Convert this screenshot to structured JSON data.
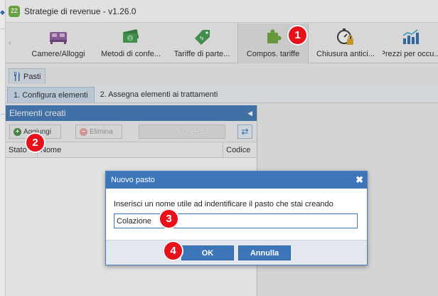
{
  "window": {
    "title": "Strategie di revenue - v1.26.0",
    "app_icon_text": "ZZ",
    "app_icon_color": "#6cb33e"
  },
  "ribbon": {
    "tabs": [
      {
        "label": "Camere/Alloggi",
        "icon": "bed-icon"
      },
      {
        "label": "Metodi di confe...",
        "icon": "money-icon"
      },
      {
        "label": "Tariffe di parte...",
        "icon": "price-tag-icon"
      },
      {
        "label": "Compos. tariffe",
        "icon": "puzzle-icon",
        "active": true
      },
      {
        "label": "Chiusura antici...",
        "icon": "stopwatch-lock-icon"
      },
      {
        "label": "Prezzi per occu...",
        "icon": "bar-chart-icon"
      }
    ]
  },
  "subtab": {
    "label": "Pasti",
    "icon": "fork-knife-icon"
  },
  "steps": [
    {
      "label": "1. Configura elementi",
      "active": true
    },
    {
      "label": "2. Assegna elementi ai trattamenti"
    }
  ],
  "panel": {
    "title": "Elementi creati",
    "add_label": "Aggiungi",
    "delete_label": "Elimina",
    "suspended_label": "SOSPESO",
    "columns": [
      "Stato",
      "Nome",
      "Codice"
    ]
  },
  "dialog": {
    "title": "Nuovo pasto",
    "prompt": "Inserisci un nome utile ad indentificare il pasto che stai creando",
    "input_value": "Colazione",
    "ok_label": "OK",
    "cancel_label": "Annulla"
  },
  "badges": [
    "1",
    "2",
    "3",
    "4"
  ],
  "colors": {
    "accent": "#3c76b9",
    "badge": "#e8101a"
  }
}
